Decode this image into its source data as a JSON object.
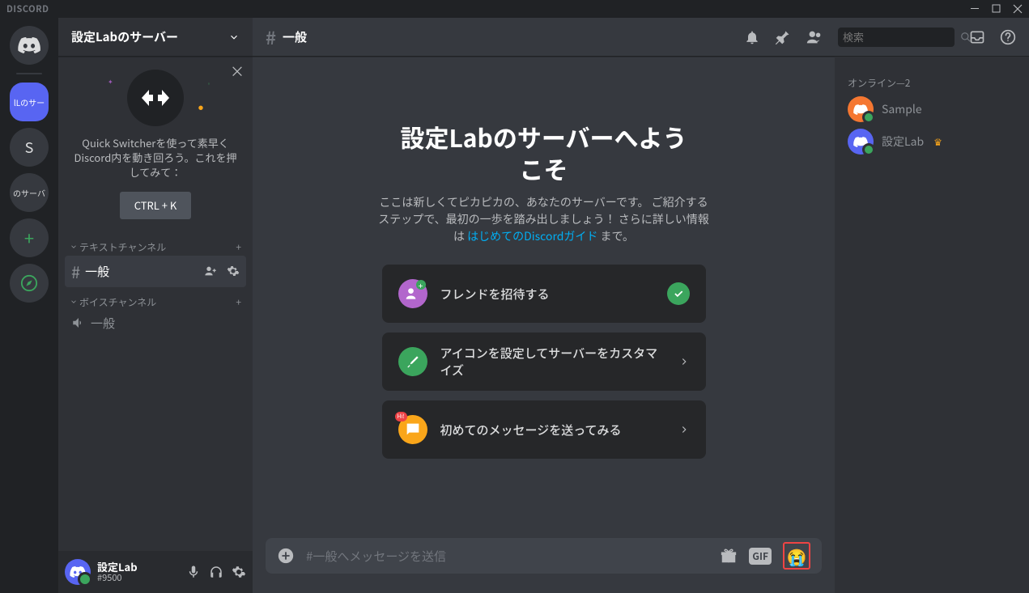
{
  "titlebar": {
    "brand": "DISCORD"
  },
  "server": {
    "name": "設定Labのサーバー"
  },
  "quickswitcher": {
    "text": "Quick Switcherを使って素早くDiscord内を動き回ろう。これを押してみて：",
    "button": "CTRL + K"
  },
  "channels": {
    "text_cat": "テキストチャンネル",
    "voice_cat": "ボイスチャンネル",
    "general": "一般",
    "voice_general": "一般"
  },
  "user": {
    "name": "設定Lab",
    "tag": "#9500"
  },
  "header": {
    "channel": "一般",
    "search_placeholder": "検索"
  },
  "welcome": {
    "title_l1": "設定Labのサーバーへよう",
    "title_l2": "こそ",
    "desc_before": "ここは新しくてピカピカの、あなたのサーバーです。 ご紹介するステップで、最初の一歩を踏み出しましょう！ さらに詳しい情報は ",
    "desc_link": "はじめてのDiscordガイド",
    "desc_after": " まで。",
    "card1": "フレンドを招待する",
    "card2": "アイコンを設定してサーバーをカスタマイズ",
    "card3": "初めてのメッセージを送ってみる"
  },
  "composer": {
    "placeholder": "#一般へメッセージを送信",
    "gif": "GIF"
  },
  "members": {
    "online_label": "オンライン—2",
    "m1": "Sample",
    "m2": "設定Lab"
  },
  "guilds": {
    "active_text": "lLのサー",
    "letter": "S",
    "other": "のサーバ"
  }
}
